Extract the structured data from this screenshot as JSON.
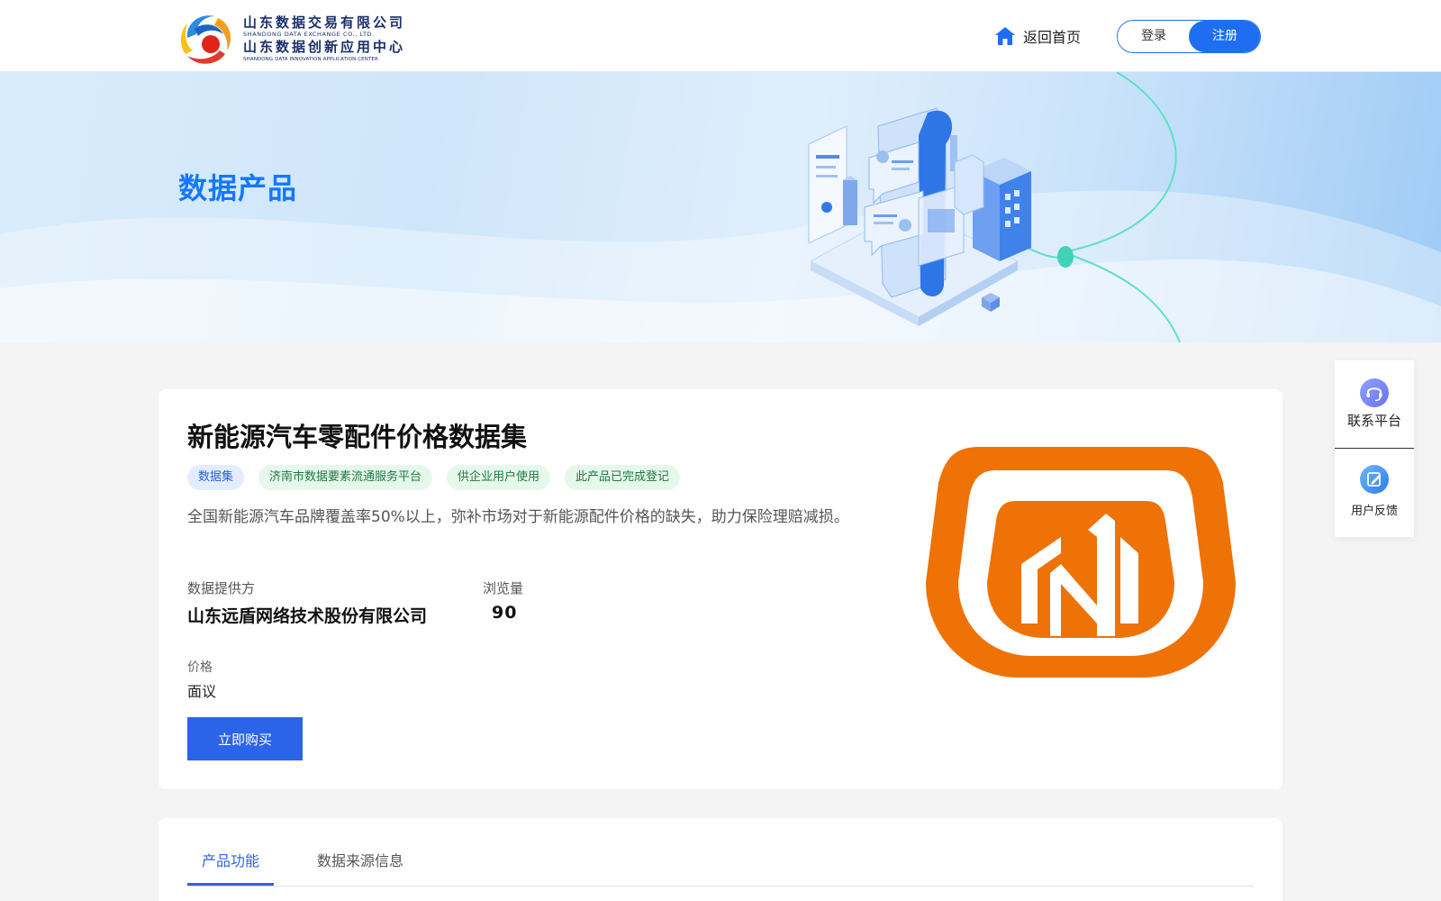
{
  "header": {
    "logo": {
      "line1": "山东数据交易有限公司",
      "line2": "SHANDONG DATA EXCHANGE CO., LTD.",
      "line3": "山东数据创新应用中心",
      "line4": "SHANDONG DATA INNOVATION APPLICATION CENTER"
    },
    "home_label": "返回首页",
    "home_icon": "home-icon",
    "login_label": "登录",
    "register_label": "注册"
  },
  "banner": {
    "title": "数据产品"
  },
  "product": {
    "title": "新能源汽车零配件价格数据集",
    "tags": [
      {
        "label": "数据集",
        "color": "blue"
      },
      {
        "label": "济南市数据要素流通服务平台",
        "color": "green"
      },
      {
        "label": "供企业用户使用",
        "color": "green"
      },
      {
        "label": "此产品已完成登记",
        "color": "green"
      }
    ],
    "description": "全国新能源汽车品牌覆盖率50%以上，弥补市场对于新能源配件价格的缺失，助力保险理赔减损。",
    "provider_label": "数据提供方",
    "provider_value": "山东远盾网络技术股份有限公司",
    "views_label": "浏览量",
    "views_value": "90",
    "price_label": "价格",
    "price_value": "面议",
    "buy_label": "立即购买"
  },
  "tabs": [
    {
      "label": "产品功能",
      "active": true
    },
    {
      "label": "数据来源信息",
      "active": false
    }
  ],
  "side_panel": {
    "contact_label": "联系平台",
    "contact_icon": "headset-icon",
    "feedback_label": "用户反馈",
    "feedback_icon": "edit-icon"
  },
  "colors": {
    "primary": "#1f6ef2",
    "banner_title": "#1677ff",
    "product_logo": "#ee7205"
  }
}
